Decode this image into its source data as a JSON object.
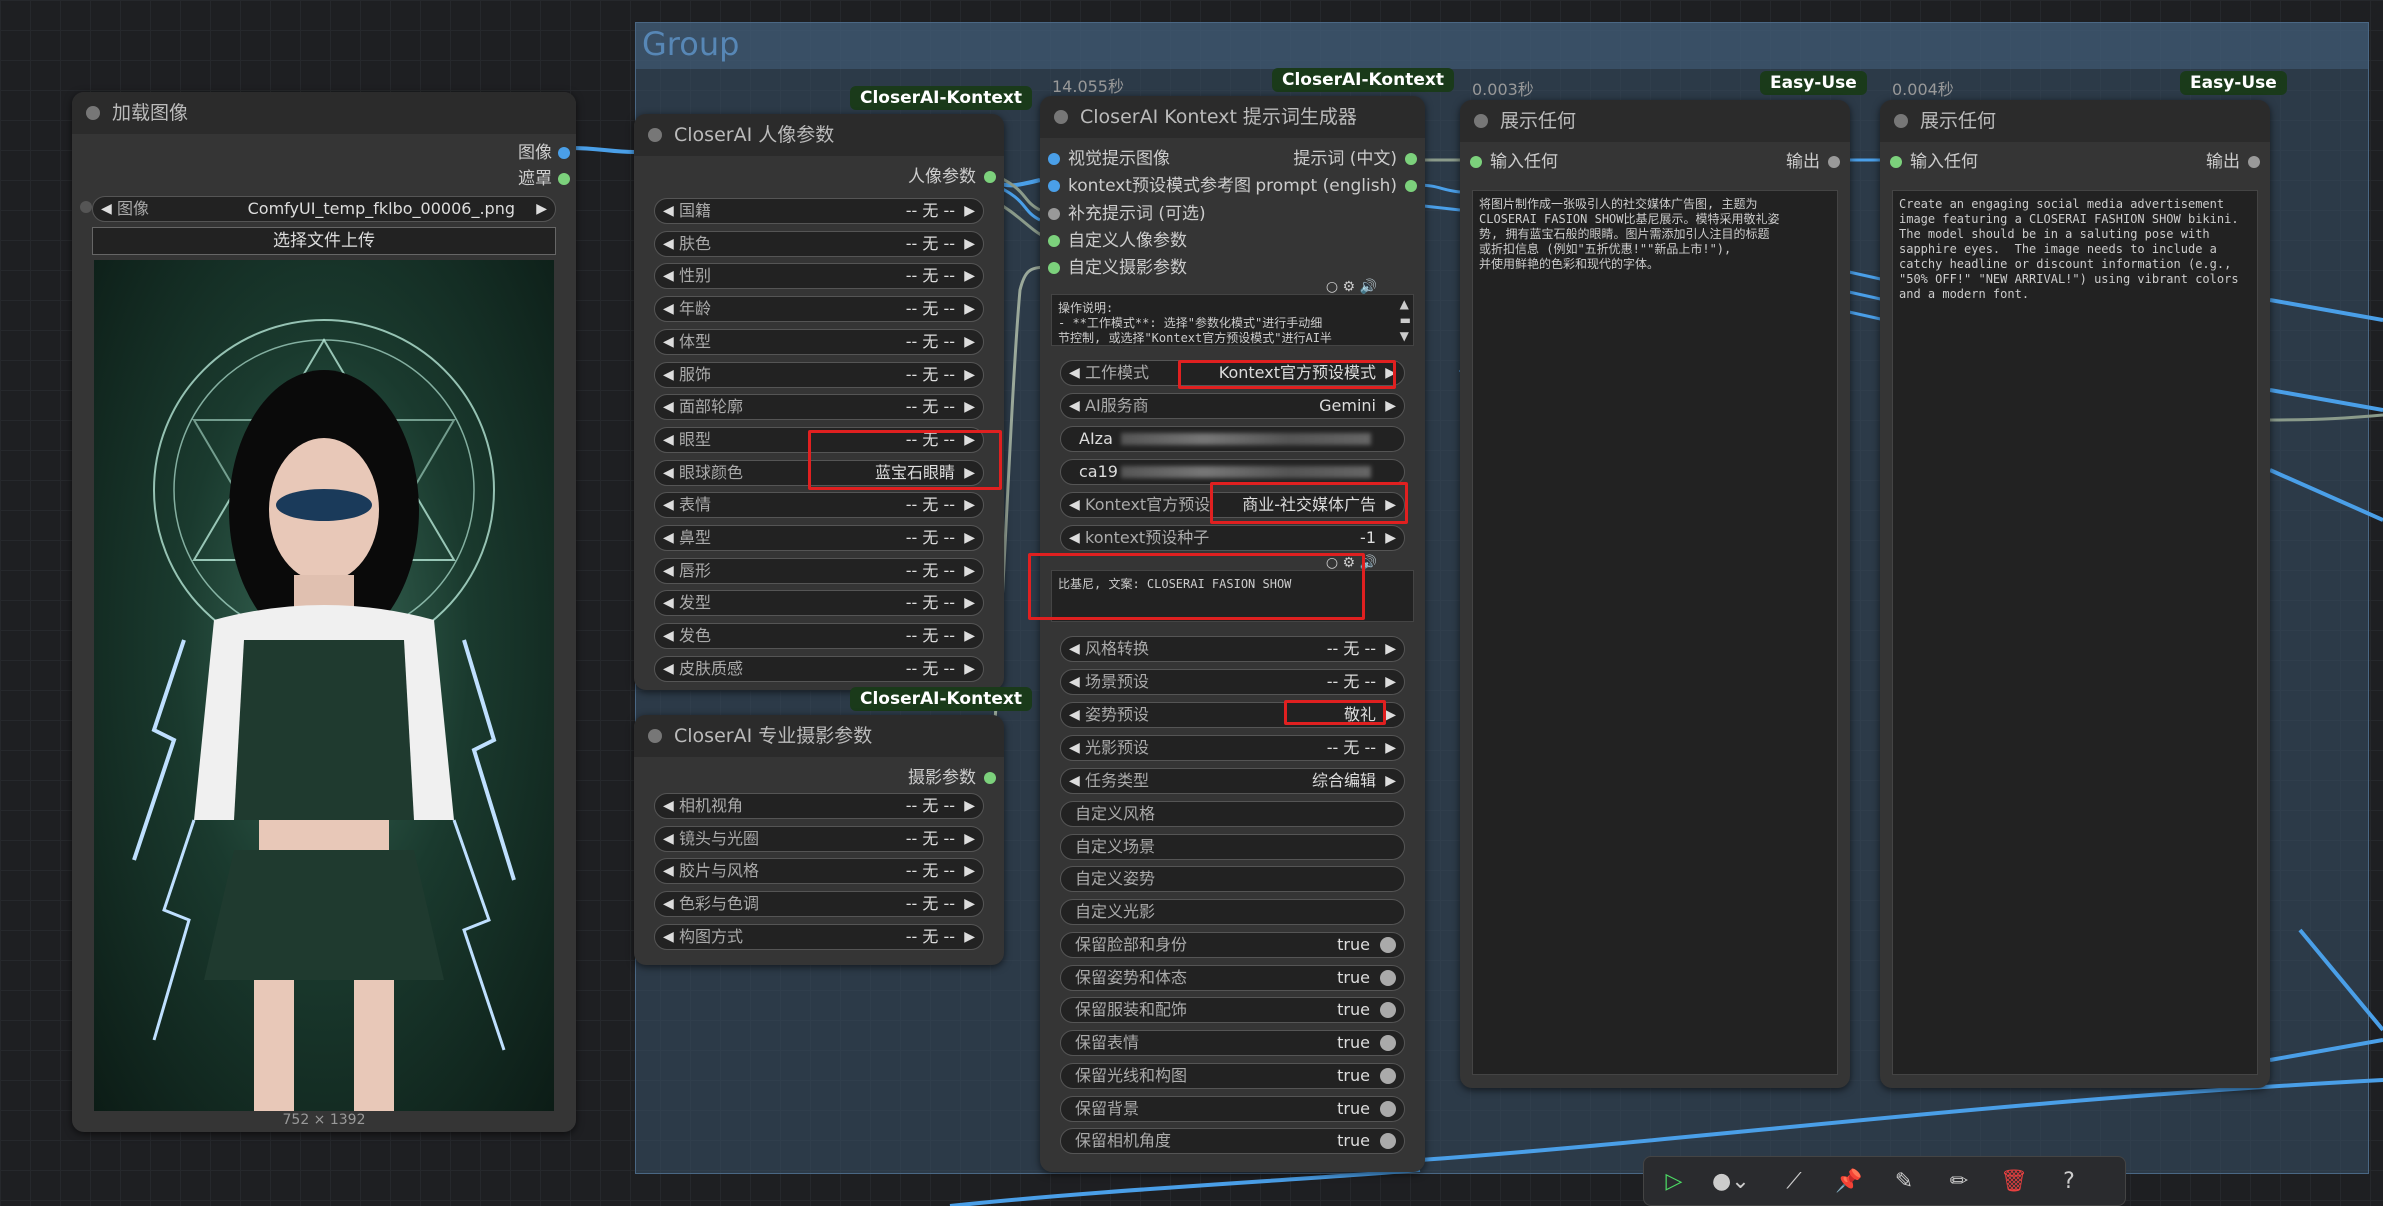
{
  "colors": {
    "group_bg": "#385068",
    "wire_blue": "#4a9fe8",
    "wire_gray": "#8a9a8a",
    "badge_green": "#1a3a1a",
    "highlight_red": "#e02020"
  },
  "group": {
    "title": "Group"
  },
  "load_image": {
    "title": "加载图像",
    "out_image": "图像",
    "out_mask": "遮罩",
    "image_label": "图像",
    "image_value": "ComfyUI_temp_fklbo_00006_.png",
    "upload_label": "选择文件上传",
    "size": "752 × 1392"
  },
  "portrait": {
    "badge": "CloserAI-Kontext",
    "title": "CloserAI 人像参数",
    "output": "人像参数",
    "params": [
      {
        "label": "国籍",
        "value": "-- 无 --"
      },
      {
        "label": "肤色",
        "value": "-- 无 --"
      },
      {
        "label": "性别",
        "value": "-- 无 --"
      },
      {
        "label": "年龄",
        "value": "-- 无 --"
      },
      {
        "label": "体型",
        "value": "-- 无 --"
      },
      {
        "label": "服饰",
        "value": "-- 无 --"
      },
      {
        "label": "面部轮廓",
        "value": "-- 无 --"
      },
      {
        "label": "眼型",
        "value": "-- 无 --"
      },
      {
        "label": "眼球颜色",
        "value": "蓝宝石眼睛"
      },
      {
        "label": "表情",
        "value": "-- 无 --"
      },
      {
        "label": "鼻型",
        "value": "-- 无 --"
      },
      {
        "label": "唇形",
        "value": "-- 无 --"
      },
      {
        "label": "发型",
        "value": "-- 无 --"
      },
      {
        "label": "发色",
        "value": "-- 无 --"
      },
      {
        "label": "皮肤质感",
        "value": "-- 无 --"
      }
    ]
  },
  "photo": {
    "badge": "CloserAI-Kontext",
    "title": "CloserAI 专业摄影参数",
    "output": "摄影参数",
    "params": [
      {
        "label": "相机视角",
        "value": "-- 无 --"
      },
      {
        "label": "镜头与光圈",
        "value": "-- 无 --"
      },
      {
        "label": "胶片与风格",
        "value": "-- 无 --"
      },
      {
        "label": "色彩与色调",
        "value": "-- 无 --"
      },
      {
        "label": "构图方式",
        "value": "-- 无 --"
      }
    ]
  },
  "kontext": {
    "timer": "14.055秒",
    "badge": "CloserAI-Kontext",
    "title": "CloserAI Kontext 提示词生成器",
    "inputs": [
      "视觉提示图像",
      "kontext预设模式参考图",
      "补充提示词 (可选)",
      "自定义人像参数",
      "自定义摄影参数"
    ],
    "outputs": [
      "提示词 (中文)",
      "prompt (english)"
    ],
    "notes": "操作说明:\n- **工作模式**: 选择\"参数化模式\"进行手动细\n节控制, 或选择\"Kontext官方预设模式\"进行AI半",
    "work_mode_label": "工作模式",
    "work_mode": "Kontext官方预设模式",
    "ai_label": "AI服务商",
    "ai_value": "Gemini",
    "key1": "AIza",
    "key2": "ca19",
    "preset_label": "Kontext官方预设",
    "preset_value": "商业-社交媒体广告",
    "seed_label": "kontext预设种子",
    "seed_value": "-1",
    "prompt_text": "比基尼, 文案: CLOSERAI FASION SHOW",
    "style_label": "风格转换",
    "style_value": "-- 无 --",
    "scene_label": "场景预设",
    "scene_value": "-- 无 --",
    "pose_label": "姿势预设",
    "pose_value": "敬礼",
    "light_label": "光影预设",
    "light_value": "-- 无 --",
    "task_label": "任务类型",
    "task_value": "综合编辑",
    "custom": [
      "自定义风格",
      "自定义场景",
      "自定义姿势",
      "自定义光影"
    ],
    "keeps": [
      {
        "label": "保留脸部和身份",
        "value": "true"
      },
      {
        "label": "保留姿势和体态",
        "value": "true"
      },
      {
        "label": "保留服装和配饰",
        "value": "true"
      },
      {
        "label": "保留表情",
        "value": "true"
      },
      {
        "label": "保留光线和构图",
        "value": "true"
      },
      {
        "label": "保留背景",
        "value": "true"
      },
      {
        "label": "保留相机角度",
        "value": "true"
      }
    ]
  },
  "show1": {
    "timer": "0.003秒",
    "badge": "Easy-Use",
    "title": "展示任何",
    "input": "输入任何",
    "output": "输出",
    "text": "将图片制作成一张吸引人的社交媒体广告图, 主题为\nCLOSERAI FASION SHOW比基尼展示。模特采用敬礼姿\n势, 拥有蓝宝石般的眼睛。图片需添加引人注目的标题\n或折扣信息 (例如\"五折优惠!\"\"新品上市!\"),\n并使用鲜艳的色彩和现代的字体。"
  },
  "show2": {
    "timer": "0.004秒",
    "badge": "Easy-Use",
    "title": "展示任何",
    "input": "输入任何",
    "output": "输出",
    "text": "Create an engaging social media advertisement\nimage featuring a CLOSERAI FASHION SHOW bikini.\nThe model should be in a saluting pose with\nsapphire eyes.  The image needs to include a\ncatchy headline or discount information (e.g.,\n\"50% OFF!\" \"NEW ARRIVAL!\") using vibrant colors\nand a modern font."
  }
}
